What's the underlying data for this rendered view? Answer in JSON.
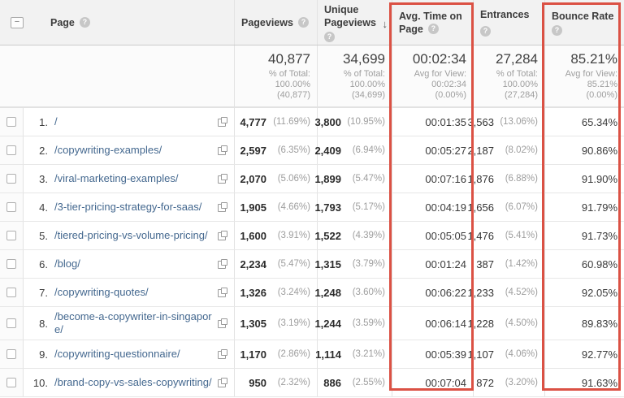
{
  "header": {
    "collapse_glyph": "−",
    "help_glyph": "?",
    "sort_arrow": "↓",
    "columns": {
      "page": "Page",
      "pageviews": "Pageviews",
      "unique_pageviews": "Unique Pageviews",
      "avg_time_line1": "Avg. Time on",
      "avg_time_line2": "Page",
      "entrances": "Entrances",
      "bounce_rate": "Bounce Rate"
    }
  },
  "summary": {
    "pageviews": {
      "value": "40,877",
      "sub1": "% of Total:",
      "sub2": "100.00%",
      "sub3": "(40,877)"
    },
    "unique_pageviews": {
      "value": "34,699",
      "sub1": "% of Total:",
      "sub2": "100.00%",
      "sub3": "(34,699)"
    },
    "avg_time": {
      "value": "00:02:34",
      "sub1": "Avg for View:",
      "sub2": "00:02:34",
      "sub3": "(0.00%)"
    },
    "entrances": {
      "value": "27,284",
      "sub1": "% of Total:",
      "sub2": "100.00%",
      "sub3": "(27,284)"
    },
    "bounce_rate": {
      "value": "85.21%",
      "sub1": "Avg for View:",
      "sub2": "85.21%",
      "sub3": "(0.00%)"
    }
  },
  "rows": [
    {
      "num": "1.",
      "page": "/",
      "pv": "4,777",
      "pv_pct": "(11.69%)",
      "upv": "3,800",
      "upv_pct": "(10.95%)",
      "time": "00:01:35",
      "ent": "3,563",
      "ent_pct": "(13.06%)",
      "bounce": "65.34%"
    },
    {
      "num": "2.",
      "page": "/copywriting-examples/",
      "pv": "2,597",
      "pv_pct": "(6.35%)",
      "upv": "2,409",
      "upv_pct": "(6.94%)",
      "time": "00:05:27",
      "ent": "2,187",
      "ent_pct": "(8.02%)",
      "bounce": "90.86%"
    },
    {
      "num": "3.",
      "page": "/viral-marketing-examples/",
      "pv": "2,070",
      "pv_pct": "(5.06%)",
      "upv": "1,899",
      "upv_pct": "(5.47%)",
      "time": "00:07:16",
      "ent": "1,876",
      "ent_pct": "(6.88%)",
      "bounce": "91.90%"
    },
    {
      "num": "4.",
      "page": "/3-tier-pricing-strategy-for-saas/",
      "pv": "1,905",
      "pv_pct": "(4.66%)",
      "upv": "1,793",
      "upv_pct": "(5.17%)",
      "time": "00:04:19",
      "ent": "1,656",
      "ent_pct": "(6.07%)",
      "bounce": "91.79%"
    },
    {
      "num": "5.",
      "page": "/tiered-pricing-vs-volume-pricing/",
      "pv": "1,600",
      "pv_pct": "(3.91%)",
      "upv": "1,522",
      "upv_pct": "(4.39%)",
      "time": "00:05:05",
      "ent": "1,476",
      "ent_pct": "(5.41%)",
      "bounce": "91.73%"
    },
    {
      "num": "6.",
      "page": "/blog/",
      "pv": "2,234",
      "pv_pct": "(5.47%)",
      "upv": "1,315",
      "upv_pct": "(3.79%)",
      "time": "00:01:24",
      "ent": "387",
      "ent_pct": "(1.42%)",
      "bounce": "60.98%"
    },
    {
      "num": "7.",
      "page": "/copywriting-quotes/",
      "pv": "1,326",
      "pv_pct": "(3.24%)",
      "upv": "1,248",
      "upv_pct": "(3.60%)",
      "time": "00:06:22",
      "ent": "1,233",
      "ent_pct": "(4.52%)",
      "bounce": "92.05%"
    },
    {
      "num": "8.",
      "page": "/become-a-copywriter-in-singapore/",
      "pv": "1,305",
      "pv_pct": "(3.19%)",
      "upv": "1,244",
      "upv_pct": "(3.59%)",
      "time": "00:06:14",
      "ent": "1,228",
      "ent_pct": "(4.50%)",
      "bounce": "89.83%"
    },
    {
      "num": "9.",
      "page": "/copywriting-questionnaire/",
      "pv": "1,170",
      "pv_pct": "(2.86%)",
      "upv": "1,114",
      "upv_pct": "(3.21%)",
      "time": "00:05:39",
      "ent": "1,107",
      "ent_pct": "(4.06%)",
      "bounce": "92.77%"
    },
    {
      "num": "10.",
      "page": "/brand-copy-vs-sales-copywriting/",
      "pv": "950",
      "pv_pct": "(2.32%)",
      "upv": "886",
      "upv_pct": "(2.55%)",
      "time": "00:07:04",
      "ent": "872",
      "ent_pct": "(3.20%)",
      "bounce": "91.63%"
    }
  ],
  "highlight_color": "#db5144"
}
